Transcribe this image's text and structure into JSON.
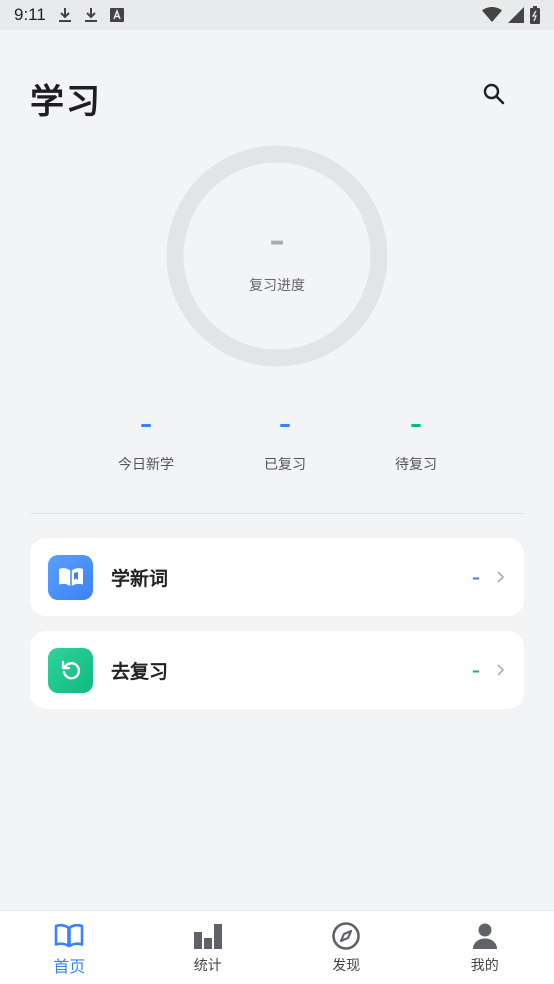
{
  "status_bar": {
    "time": "9:11",
    "left_icons": [
      "download-icon",
      "download-icon",
      "font-icon"
    ],
    "right_icons": [
      "wifi-icon",
      "signal-icon",
      "battery-icon"
    ]
  },
  "header": {
    "title": "学习",
    "search_icon": "search-icon"
  },
  "progress": {
    "value": "–",
    "label": "复习进度"
  },
  "stats": [
    {
      "value": "–",
      "label": "今日新学",
      "color": "#3b82f6"
    },
    {
      "value": "–",
      "label": "已复习",
      "color": "#3b82f6"
    },
    {
      "value": "–",
      "label": "待复习",
      "color": "#10b981"
    }
  ],
  "cards": [
    {
      "title": "学新词",
      "count": "–",
      "icon": "book-open-icon",
      "color": "#3b82f6"
    },
    {
      "title": "去复习",
      "count": "–",
      "icon": "refresh-icon",
      "color": "#10b981"
    }
  ],
  "bottom_nav": [
    {
      "label": "首页",
      "icon": "book-icon",
      "active": true
    },
    {
      "label": "统计",
      "icon": "bar-chart-icon",
      "active": false
    },
    {
      "label": "发现",
      "icon": "compass-icon",
      "active": false
    },
    {
      "label": "我的",
      "icon": "person-icon",
      "active": false
    }
  ],
  "colors": {
    "accent_blue": "#3b82f6",
    "accent_green": "#10b981",
    "background": "#f3f4f6"
  }
}
